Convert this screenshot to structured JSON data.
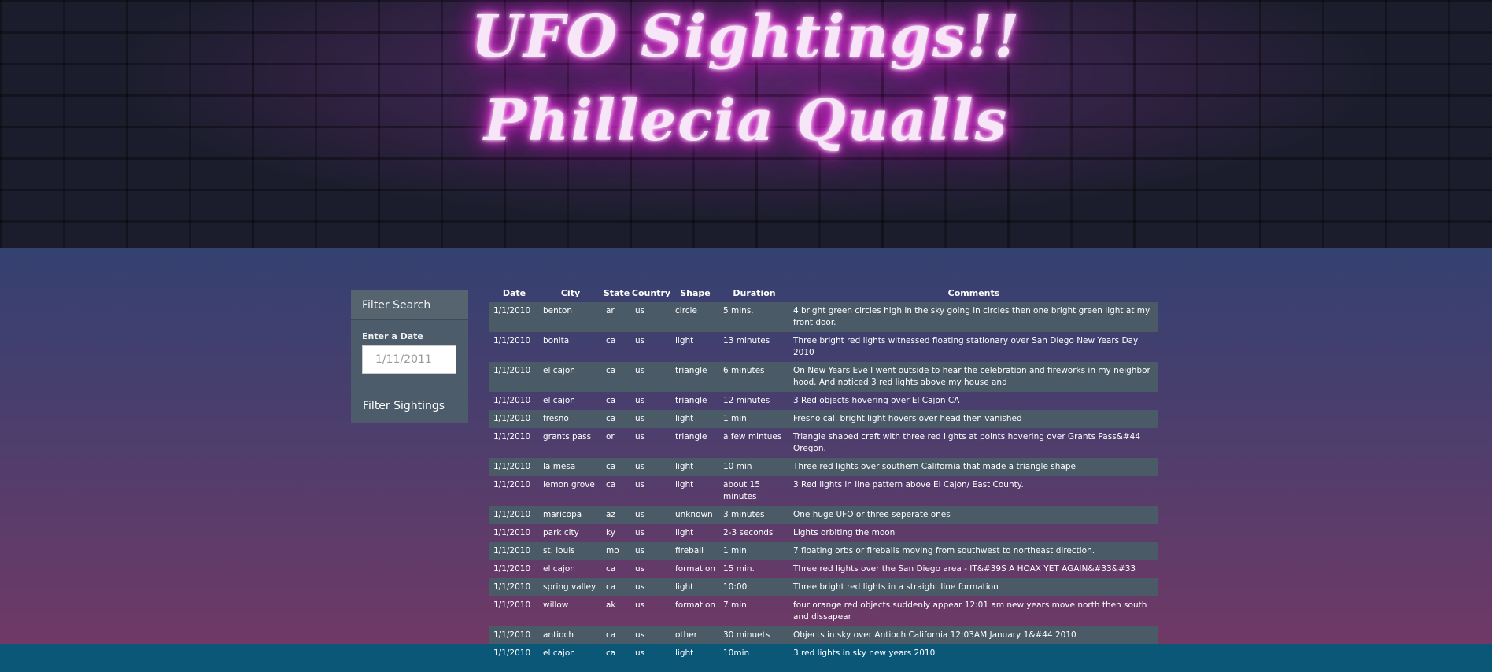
{
  "header": {
    "title_line1": "UFO Sightings!!",
    "title_line2": "Phillecia Qualls"
  },
  "filter": {
    "title": "Filter Search",
    "date_label": "Enter a Date",
    "date_placeholder": "1/11/2011",
    "button_label": "Filter Sightings"
  },
  "table": {
    "headers": [
      "Date",
      "City",
      "State",
      "Country",
      "Shape",
      "Duration",
      "Comments"
    ],
    "rows": [
      [
        "1/1/2010",
        "benton",
        "ar",
        "us",
        "circle",
        "5 mins.",
        "4 bright green circles high in the sky going in circles then one bright green light at my front door."
      ],
      [
        "1/1/2010",
        "bonita",
        "ca",
        "us",
        "light",
        "13 minutes",
        "Three bright red lights witnessed floating stationary over San Diego New Years Day 2010"
      ],
      [
        "1/1/2010",
        "el cajon",
        "ca",
        "us",
        "triangle",
        "6 minutes",
        "On New Years Eve I went outside to hear the celebration and fireworks in my neighbor hood. And noticed 3 red lights above my house and"
      ],
      [
        "1/1/2010",
        "el cajon",
        "ca",
        "us",
        "triangle",
        "12 minutes",
        "3 Red objects hovering over El Cajon CA"
      ],
      [
        "1/1/2010",
        "fresno",
        "ca",
        "us",
        "light",
        "1 min",
        "Fresno cal. bright light hovers over head then vanished"
      ],
      [
        "1/1/2010",
        "grants pass",
        "or",
        "us",
        "triangle",
        "a few mintues",
        "Triangle shaped craft with three red lights at points hovering over Grants Pass&#44 Oregon."
      ],
      [
        "1/1/2010",
        "la mesa",
        "ca",
        "us",
        "light",
        "10 min",
        "Three red lights over southern California that made a triangle shape"
      ],
      [
        "1/1/2010",
        "lemon grove",
        "ca",
        "us",
        "light",
        "about 15 minutes",
        "3 Red lights in line pattern above El Cajon/ East County."
      ],
      [
        "1/1/2010",
        "maricopa",
        "az",
        "us",
        "unknown",
        "3 minutes",
        "One huge UFO or three seperate ones"
      ],
      [
        "1/1/2010",
        "park city",
        "ky",
        "us",
        "light",
        "2-3 seconds",
        "Lights orbiting the moon"
      ],
      [
        "1/1/2010",
        "st. louis",
        "mo",
        "us",
        "fireball",
        "1 min",
        "7 floating orbs or fireballs moving from southwest to northeast direction."
      ],
      [
        "1/1/2010",
        "el cajon",
        "ca",
        "us",
        "formation",
        "15 min.",
        "Three red lights over the San Diego area - IT&#39S A HOAX YET AGAIN&#33&#33"
      ],
      [
        "1/1/2010",
        "spring valley",
        "ca",
        "us",
        "light",
        "10:00",
        "Three bright red lights in a straight line formation"
      ],
      [
        "1/1/2010",
        "willow",
        "ak",
        "us",
        "formation",
        "7 min",
        "four orange red objects suddenly appear 12:01 am new years move north then south and dissapear"
      ],
      [
        "1/1/2010",
        "antioch",
        "ca",
        "us",
        "other",
        "30 minuets",
        "Objects in sky over Antioch California 12:03AM January 1&#44 2010"
      ],
      [
        "1/1/2010",
        "el cajon",
        "ca",
        "us",
        "light",
        "10min",
        "3 red lights in sky new years 2010"
      ]
    ]
  }
}
